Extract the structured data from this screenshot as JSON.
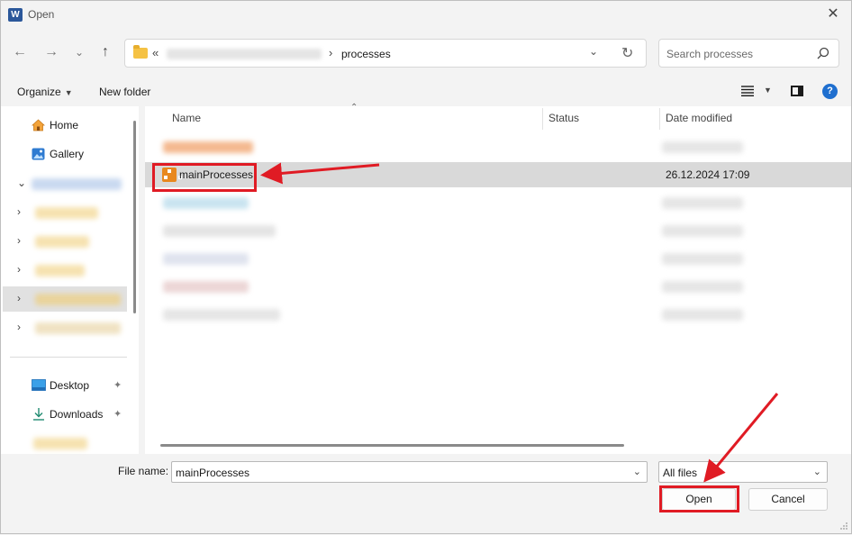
{
  "window": {
    "title": "Open",
    "app_icon": "word-icon",
    "close_glyph": "✕"
  },
  "navigation": {
    "back_glyph": "←",
    "forward_glyph": "→",
    "recent_glyph": "⌄",
    "up_glyph": "↑"
  },
  "address_bar": {
    "overflow_glyph": "«",
    "separator_glyph": "›",
    "current_folder": "processes",
    "dropdown_glyph": "⌄",
    "refresh_glyph": "↻"
  },
  "search": {
    "placeholder": "Search processes"
  },
  "toolbar": {
    "organize_label": "Organize",
    "new_folder_label": "New folder",
    "help_glyph": "?"
  },
  "sidebar": {
    "items": [
      {
        "label": "Home",
        "icon": "home-icon"
      },
      {
        "label": "Gallery",
        "icon": "gallery-icon"
      }
    ],
    "pinned": [
      {
        "label": "Desktop",
        "icon": "desktop-icon"
      },
      {
        "label": "Downloads",
        "icon": "download-icon"
      }
    ],
    "expand_glyph": "›",
    "collapse_glyph": "⌄",
    "pin_glyph": "📌"
  },
  "file_list": {
    "columns": [
      "Name",
      "Status",
      "Date modified"
    ],
    "selected_file": {
      "name": "mainProcesses",
      "date_modified": "26.12.2024 17:09",
      "icon": "orange-process-file-icon"
    }
  },
  "footer": {
    "file_name_label": "File name:",
    "file_name_value": "mainProcesses",
    "file_type_value": "All files",
    "open_label": "Open",
    "cancel_label": "Cancel"
  },
  "colors": {
    "highlight_red": "#e01b24",
    "accent_blue": "#1f6fcf",
    "selection_gray": "#d9d9d9"
  }
}
